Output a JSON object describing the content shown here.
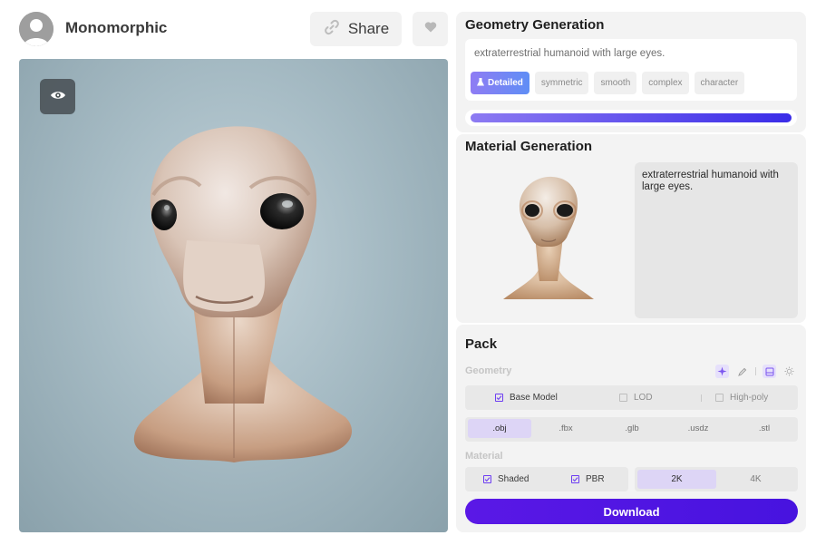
{
  "header": {
    "username": "Monomorphic",
    "share_label": "Share"
  },
  "geometry": {
    "title": "Geometry Generation",
    "prompt": "extraterrestrial humanoid with large eyes.",
    "tags": [
      {
        "label": "Detailed",
        "active": true
      },
      {
        "label": "symmetric",
        "active": false
      },
      {
        "label": "smooth",
        "active": false
      },
      {
        "label": "complex",
        "active": false
      },
      {
        "label": "character",
        "active": false
      }
    ],
    "progress": 1.0
  },
  "material": {
    "title": "Material Generation",
    "description": "extraterrestrial humanoid with large eyes."
  },
  "pack": {
    "title": "Pack",
    "geometry_label": "Geometry",
    "geometry_options": [
      {
        "label": "Base Model",
        "checked": true
      },
      {
        "label": "LOD",
        "checked": false
      },
      {
        "label": "High-poly",
        "checked": false
      }
    ],
    "formats": [
      {
        "label": ".obj",
        "active": true
      },
      {
        "label": ".fbx",
        "active": false
      },
      {
        "label": ".glb",
        "active": false
      },
      {
        "label": ".usdz",
        "active": false
      },
      {
        "label": ".stl",
        "active": false
      }
    ],
    "material_label": "Material",
    "material_options": [
      {
        "label": "Shaded",
        "checked": true
      },
      {
        "label": "PBR",
        "checked": true
      }
    ],
    "resolutions": [
      {
        "label": "2K",
        "active": true
      },
      {
        "label": "4K",
        "active": false
      }
    ],
    "download_label": "Download"
  },
  "colors": {
    "accent": "#5a18e6",
    "accent_light": "#ddd5f6",
    "panel_bg": "#f3f3f3"
  },
  "icons": [
    "user-avatar-icon",
    "link-icon",
    "heart-icon",
    "eye-icon",
    "sparkle-icon",
    "pencil-icon",
    "layout-icon",
    "sun-icon",
    "checkbox-icon"
  ]
}
